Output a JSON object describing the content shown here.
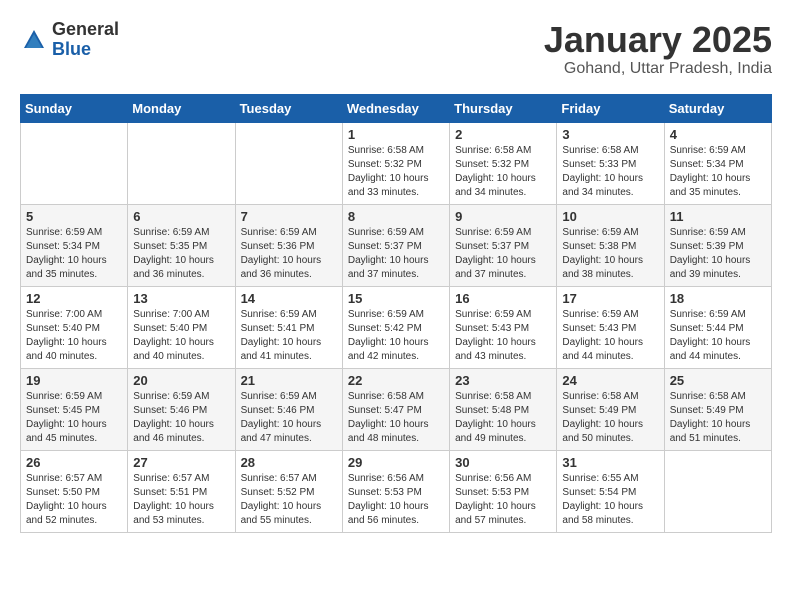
{
  "header": {
    "logo_general": "General",
    "logo_blue": "Blue",
    "month_title": "January 2025",
    "location": "Gohand, Uttar Pradesh, India"
  },
  "days_of_week": [
    "Sunday",
    "Monday",
    "Tuesday",
    "Wednesday",
    "Thursday",
    "Friday",
    "Saturday"
  ],
  "weeks": [
    [
      {
        "day": "",
        "info": ""
      },
      {
        "day": "",
        "info": ""
      },
      {
        "day": "",
        "info": ""
      },
      {
        "day": "1",
        "info": "Sunrise: 6:58 AM\nSunset: 5:32 PM\nDaylight: 10 hours\nand 33 minutes."
      },
      {
        "day": "2",
        "info": "Sunrise: 6:58 AM\nSunset: 5:32 PM\nDaylight: 10 hours\nand 34 minutes."
      },
      {
        "day": "3",
        "info": "Sunrise: 6:58 AM\nSunset: 5:33 PM\nDaylight: 10 hours\nand 34 minutes."
      },
      {
        "day": "4",
        "info": "Sunrise: 6:59 AM\nSunset: 5:34 PM\nDaylight: 10 hours\nand 35 minutes."
      }
    ],
    [
      {
        "day": "5",
        "info": "Sunrise: 6:59 AM\nSunset: 5:34 PM\nDaylight: 10 hours\nand 35 minutes."
      },
      {
        "day": "6",
        "info": "Sunrise: 6:59 AM\nSunset: 5:35 PM\nDaylight: 10 hours\nand 36 minutes."
      },
      {
        "day": "7",
        "info": "Sunrise: 6:59 AM\nSunset: 5:36 PM\nDaylight: 10 hours\nand 36 minutes."
      },
      {
        "day": "8",
        "info": "Sunrise: 6:59 AM\nSunset: 5:37 PM\nDaylight: 10 hours\nand 37 minutes."
      },
      {
        "day": "9",
        "info": "Sunrise: 6:59 AM\nSunset: 5:37 PM\nDaylight: 10 hours\nand 37 minutes."
      },
      {
        "day": "10",
        "info": "Sunrise: 6:59 AM\nSunset: 5:38 PM\nDaylight: 10 hours\nand 38 minutes."
      },
      {
        "day": "11",
        "info": "Sunrise: 6:59 AM\nSunset: 5:39 PM\nDaylight: 10 hours\nand 39 minutes."
      }
    ],
    [
      {
        "day": "12",
        "info": "Sunrise: 7:00 AM\nSunset: 5:40 PM\nDaylight: 10 hours\nand 40 minutes."
      },
      {
        "day": "13",
        "info": "Sunrise: 7:00 AM\nSunset: 5:40 PM\nDaylight: 10 hours\nand 40 minutes."
      },
      {
        "day": "14",
        "info": "Sunrise: 6:59 AM\nSunset: 5:41 PM\nDaylight: 10 hours\nand 41 minutes."
      },
      {
        "day": "15",
        "info": "Sunrise: 6:59 AM\nSunset: 5:42 PM\nDaylight: 10 hours\nand 42 minutes."
      },
      {
        "day": "16",
        "info": "Sunrise: 6:59 AM\nSunset: 5:43 PM\nDaylight: 10 hours\nand 43 minutes."
      },
      {
        "day": "17",
        "info": "Sunrise: 6:59 AM\nSunset: 5:43 PM\nDaylight: 10 hours\nand 44 minutes."
      },
      {
        "day": "18",
        "info": "Sunrise: 6:59 AM\nSunset: 5:44 PM\nDaylight: 10 hours\nand 44 minutes."
      }
    ],
    [
      {
        "day": "19",
        "info": "Sunrise: 6:59 AM\nSunset: 5:45 PM\nDaylight: 10 hours\nand 45 minutes."
      },
      {
        "day": "20",
        "info": "Sunrise: 6:59 AM\nSunset: 5:46 PM\nDaylight: 10 hours\nand 46 minutes."
      },
      {
        "day": "21",
        "info": "Sunrise: 6:59 AM\nSunset: 5:46 PM\nDaylight: 10 hours\nand 47 minutes."
      },
      {
        "day": "22",
        "info": "Sunrise: 6:58 AM\nSunset: 5:47 PM\nDaylight: 10 hours\nand 48 minutes."
      },
      {
        "day": "23",
        "info": "Sunrise: 6:58 AM\nSunset: 5:48 PM\nDaylight: 10 hours\nand 49 minutes."
      },
      {
        "day": "24",
        "info": "Sunrise: 6:58 AM\nSunset: 5:49 PM\nDaylight: 10 hours\nand 50 minutes."
      },
      {
        "day": "25",
        "info": "Sunrise: 6:58 AM\nSunset: 5:49 PM\nDaylight: 10 hours\nand 51 minutes."
      }
    ],
    [
      {
        "day": "26",
        "info": "Sunrise: 6:57 AM\nSunset: 5:50 PM\nDaylight: 10 hours\nand 52 minutes."
      },
      {
        "day": "27",
        "info": "Sunrise: 6:57 AM\nSunset: 5:51 PM\nDaylight: 10 hours\nand 53 minutes."
      },
      {
        "day": "28",
        "info": "Sunrise: 6:57 AM\nSunset: 5:52 PM\nDaylight: 10 hours\nand 55 minutes."
      },
      {
        "day": "29",
        "info": "Sunrise: 6:56 AM\nSunset: 5:53 PM\nDaylight: 10 hours\nand 56 minutes."
      },
      {
        "day": "30",
        "info": "Sunrise: 6:56 AM\nSunset: 5:53 PM\nDaylight: 10 hours\nand 57 minutes."
      },
      {
        "day": "31",
        "info": "Sunrise: 6:55 AM\nSunset: 5:54 PM\nDaylight: 10 hours\nand 58 minutes."
      },
      {
        "day": "",
        "info": ""
      }
    ]
  ]
}
